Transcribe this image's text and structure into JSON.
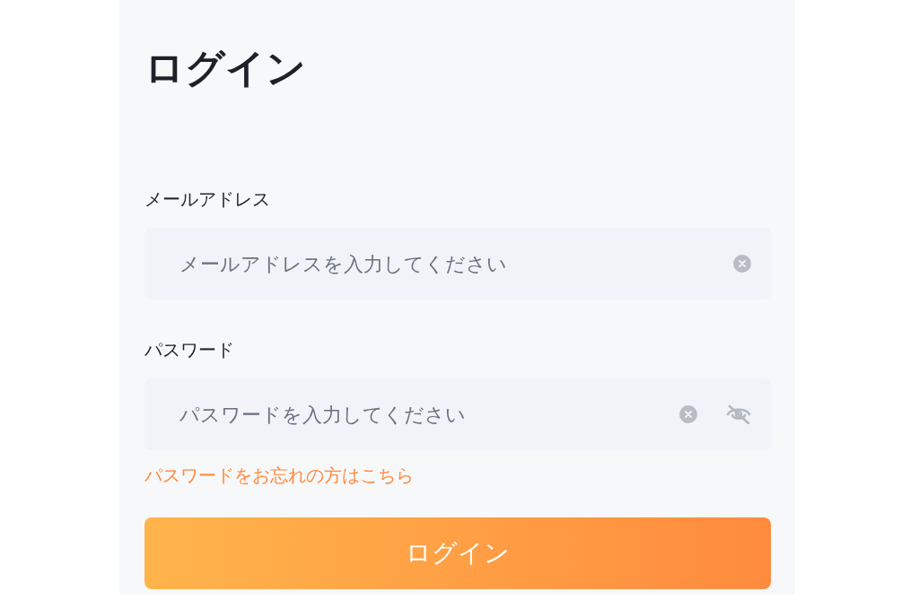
{
  "title": "ログイン",
  "fields": [
    {
      "kind": "email",
      "label": "メールアドレス",
      "placeholder": "メールアドレスを入力してください"
    },
    {
      "kind": "password",
      "label": "パスワード",
      "placeholder": "パスワードを入力してください"
    }
  ],
  "forgot_link": "パスワードをお忘れの方はこちら",
  "submit_button": "ログイン"
}
